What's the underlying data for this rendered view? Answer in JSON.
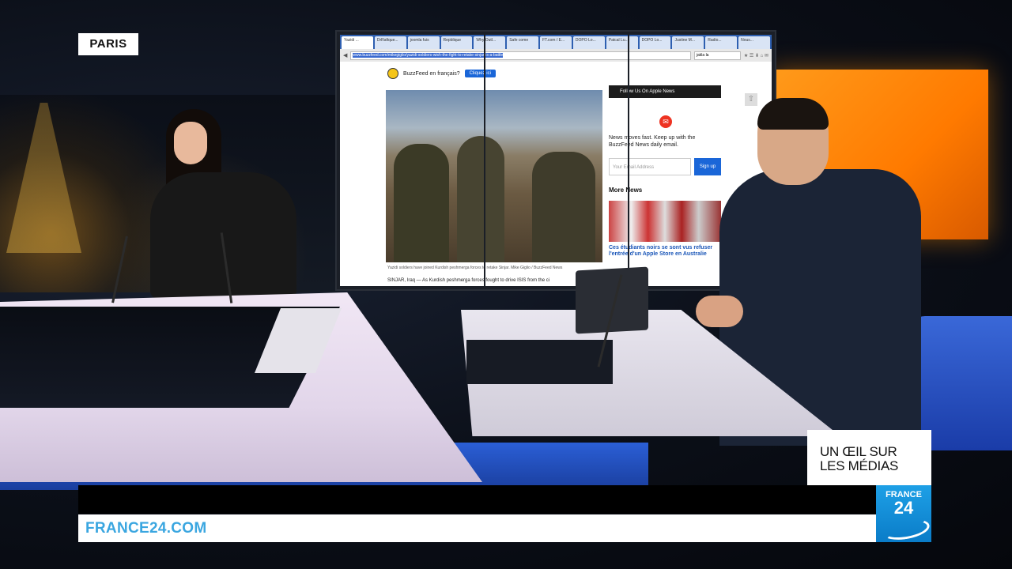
{
  "overlay": {
    "location_tag": "PARIS",
    "show_title_line1": "UN ŒIL SUR",
    "show_title_line2": "LES MÉDIAS",
    "website": "FRANCE24.COM",
    "logo_line1": "FRANCE",
    "logo_line2": "24"
  },
  "browser": {
    "tabs": [
      "Yazidi ...",
      "DrRafique...",
      "joomla fuis",
      "Repblique",
      "Why Outl...",
      "Safe come",
      "FT.com / E...",
      "DOPO Lo...",
      "Patcal Lu...",
      "DOPO Lo...",
      "Justine M...",
      "Radio...",
      "Nous..."
    ],
    "url": "www.buzzfeed.com/mikegiglio/yazidi-soldiers-wish-the-fight-to-retake-sinjar-is-a-battle",
    "search_value": "jakla la"
  },
  "article": {
    "buzzfeed_prompt": "BuzzFeed en français?",
    "buzzfeed_button": "Cliquez ici",
    "photo_caption": "Yazidi soldiers have joined Kurdish peshmerga forces to retake Sinjar.  Mike Giglio / BuzzFeed News",
    "lead": "SINJAR, Iraq — As Kurdish peshmerga forces fought to drive ISIS from the ci"
  },
  "sidebar": {
    "follow_bar": "Follow Us On Apple News",
    "newsletter_text": "News moves fast. Keep up with the BuzzFeed News daily email.",
    "email_placeholder": "Your Email Address",
    "signup_label": "Sign up",
    "more_news": "More News",
    "headline": "Ces étudiants noirs se sont vus refuser l'entrée d'un Apple Store en Australie"
  },
  "colors": {
    "france24_blue": "#1ea0e6",
    "buzzfeed_blue": "#1a66d8",
    "studio_orange": "#ff8a00"
  }
}
